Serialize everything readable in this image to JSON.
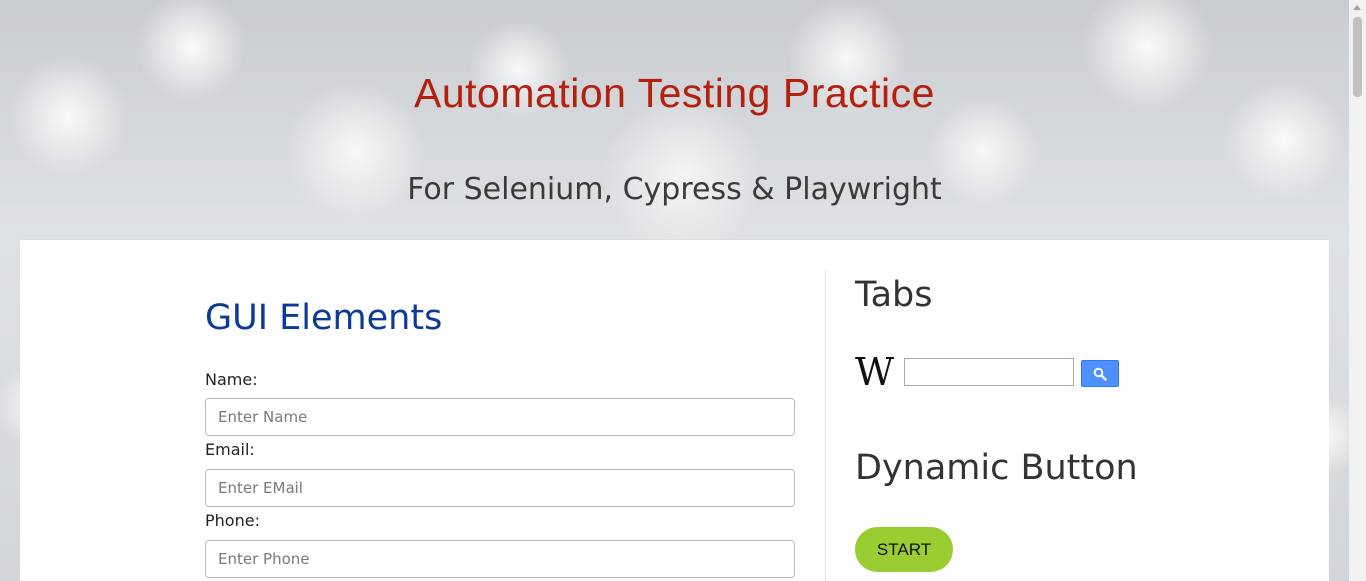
{
  "header": {
    "title": "Automation Testing Practice",
    "subtitle": "For Selenium, Cypress & Playwright"
  },
  "gui": {
    "heading": "GUI Elements",
    "fields": [
      {
        "label": "Name:",
        "placeholder": "Enter Name",
        "value": ""
      },
      {
        "label": "Email:",
        "placeholder": "Enter EMail",
        "value": ""
      },
      {
        "label": "Phone:",
        "placeholder": "Enter Phone",
        "value": ""
      }
    ]
  },
  "sidebar": {
    "tabs_heading": "Tabs",
    "wiki_logo": "W",
    "wiki_icon": "wikipedia-icon",
    "search_icon": "search-icon",
    "dynamic_heading": "Dynamic Button",
    "start_label": "START"
  },
  "colors": {
    "title": "#b5200d",
    "gui_heading": "#0b3a99",
    "search_button": "#4d90fe",
    "start_button": "#9acd32"
  }
}
